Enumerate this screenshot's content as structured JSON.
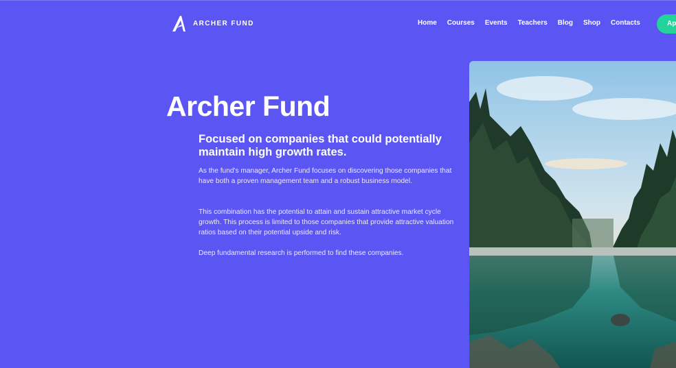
{
  "header": {
    "logo_text": "ARCHER FUND",
    "nav": [
      "Home",
      "Courses",
      "Events",
      "Teachers",
      "Blog",
      "Shop",
      "Contacts"
    ],
    "cta_label": "Ap"
  },
  "hero": {
    "title": "Archer Fund",
    "subtitle": "Focused on companies that could potentially maintain high growth rates.",
    "paragraphs": [
      "As the fund's manager, Archer Fund focuses on discovering those companies that have both a proven management team and a robust business model.",
      "This combination has the potential to attain and sustain attractive market cycle growth. This process is limited to those companies that provide attractive valuation ratios based on their potential upside and risk.",
      "Deep fundamental research is performed to find these companies."
    ]
  },
  "image": {
    "subject": "forest lake landscape"
  },
  "colors": {
    "background": "#5B55F4",
    "accent": "#22D49A",
    "text": "#FFFFFF"
  }
}
